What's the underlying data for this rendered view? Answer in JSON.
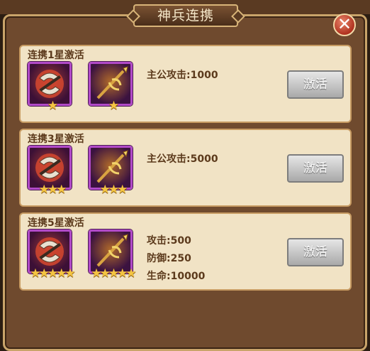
{
  "window": {
    "title": "神兵连携",
    "close_symbol": "✕",
    "colors": {
      "accent_gold": "#d8b479",
      "panel_brown": "#6f4a2e",
      "card_bg": "#f1e3c5",
      "star": "#f4c542"
    }
  },
  "tiers": [
    {
      "title": "连携1星激活",
      "weapons": [
        {
          "icon": "battle-axe-icon",
          "stars": "★"
        },
        {
          "icon": "golden-spear-icon",
          "stars": "★"
        }
      ],
      "stats": [
        "主公攻击:1000"
      ],
      "button": "激活"
    },
    {
      "title": "连携3星激活",
      "weapons": [
        {
          "icon": "battle-axe-icon",
          "stars": "★★★"
        },
        {
          "icon": "golden-spear-icon",
          "stars": "★★★"
        }
      ],
      "stats": [
        "主公攻击:5000"
      ],
      "button": "激活"
    },
    {
      "title": "连携5星激活",
      "weapons": [
        {
          "icon": "battle-axe-icon",
          "stars": "★★★★★"
        },
        {
          "icon": "golden-spear-icon",
          "stars": "★★★★★"
        }
      ],
      "stats": [
        "攻击:500",
        "防御:250",
        "生命:10000"
      ],
      "button": "激活"
    }
  ]
}
